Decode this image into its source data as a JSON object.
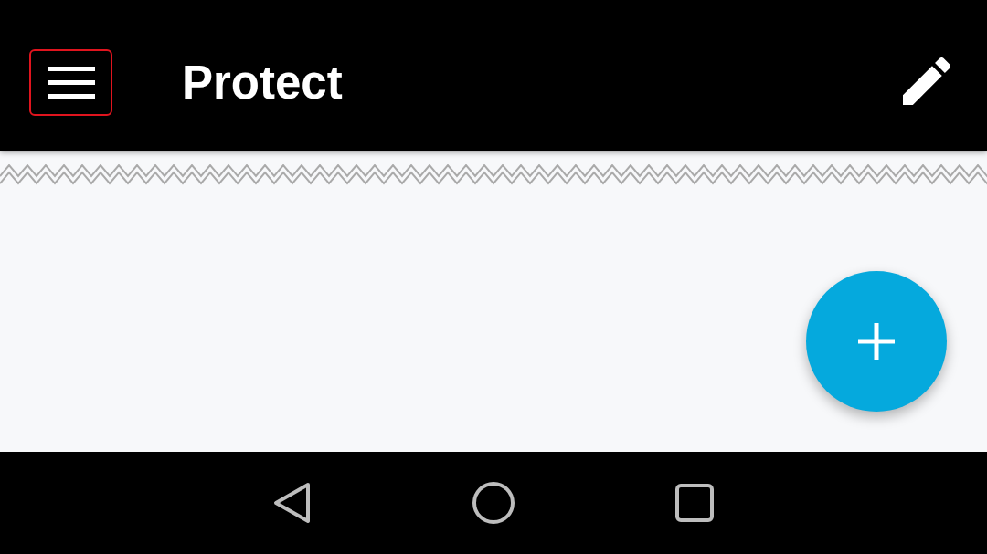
{
  "app_bar": {
    "title": "Protect",
    "menu_button": {
      "focused": true
    }
  }
}
